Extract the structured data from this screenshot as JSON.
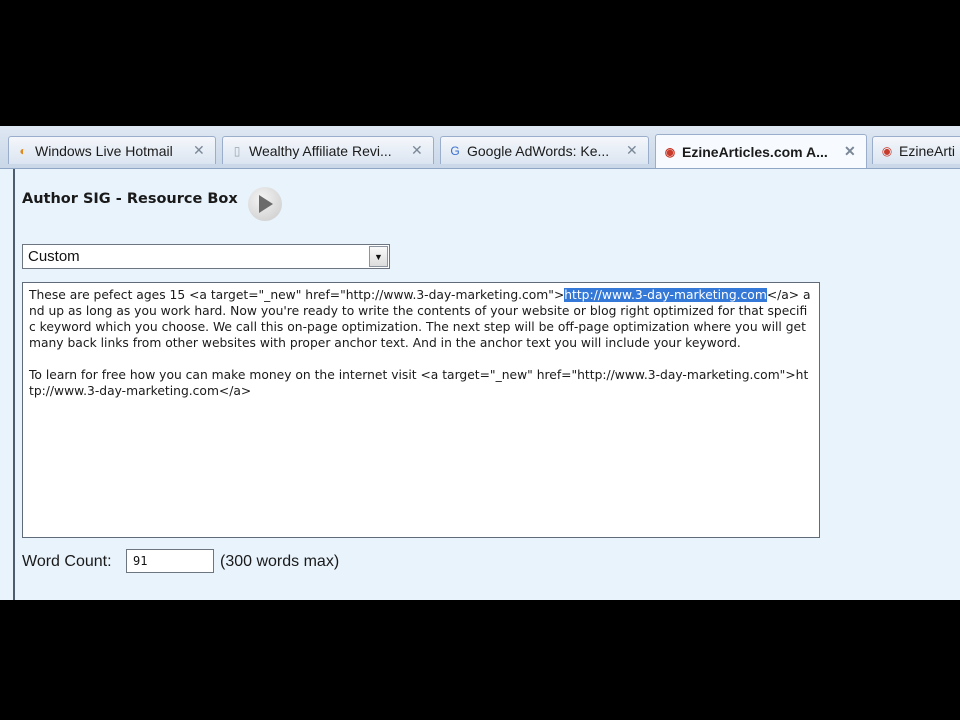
{
  "tabs": [
    {
      "label": "Windows Live Hotmail",
      "icon": "hotmail-icon",
      "glyph": "◐",
      "color": "#e08a1e",
      "active": false
    },
    {
      "label": "Wealthy Affiliate Revi...",
      "icon": "page-icon",
      "glyph": "▯",
      "color": "#9aa3ad",
      "active": false
    },
    {
      "label": "Google AdWords: Ke...",
      "icon": "google-icon",
      "glyph": "G",
      "color": "#3b6fd0",
      "active": false
    },
    {
      "label": "EzineArticles.com A...",
      "icon": "ezinearticles-icon",
      "glyph": "◉",
      "color": "#c83a2a",
      "active": true
    },
    {
      "label": "EzineArti",
      "icon": "ezinearticles-icon",
      "glyph": "◉",
      "color": "#c83a2a",
      "active": false
    }
  ],
  "section": {
    "title": "Author SIG - Resource Box"
  },
  "signature_select": {
    "value": "Custom"
  },
  "resource_box": {
    "para1_pre": "These are pefect ages 15 <a target=\"_new\" href=\"http://www.3-day-marketing.com\">",
    "para1_selected": "http://www.3-day-marketing.com",
    "para1_post": "</a> and up as long as you work hard. Now you're ready to write the contents of your website or blog right optimized for that specific keyword which you choose.  We call this on-page optimization. The next step will be off-page optimization where you will get many back links from other websites with proper anchor text. And in the anchor text you will include your keyword.",
    "para2": "To learn for free how you can make money on the internet visit <a target=\"_new\" href=\"http://www.3-day-marketing.com\">http://www.3-day-marketing.com</a>"
  },
  "word_count": {
    "label": "Word Count:",
    "value": "91",
    "note": "(300 words max)"
  }
}
